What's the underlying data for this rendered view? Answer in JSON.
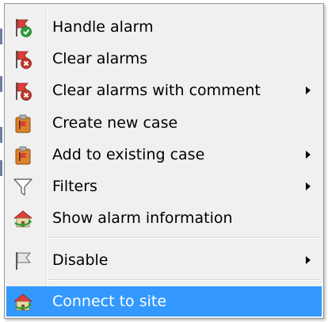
{
  "menu": {
    "items": [
      {
        "label": "Handle alarm",
        "icon": "handle-alarm-icon",
        "has_submenu": false
      },
      {
        "label": "Clear alarms",
        "icon": "clear-alarms-icon",
        "has_submenu": false
      },
      {
        "label": "Clear alarms with comment",
        "icon": "clear-alarms-comment-icon",
        "has_submenu": true
      },
      {
        "label": "Create new case",
        "icon": "create-case-icon",
        "has_submenu": false
      },
      {
        "label": "Add to existing case",
        "icon": "add-case-icon",
        "has_submenu": true
      },
      {
        "label": "Filters",
        "icon": "filter-icon",
        "has_submenu": true
      },
      {
        "label": "Show alarm information",
        "icon": "alarm-info-icon",
        "has_submenu": false
      },
      {
        "label": "Disable",
        "icon": "disable-flag-icon",
        "has_submenu": true
      },
      {
        "label": "Connect to site",
        "icon": "connect-site-icon",
        "has_submenu": false,
        "selected": true
      }
    ]
  },
  "colors": {
    "menu_bg": "#f0f0f0",
    "selection": "#3399ff",
    "flag_red": "#d9403a",
    "check_green": "#2f9e3a",
    "clear_red": "#c0392b",
    "case_orange": "#d9822b",
    "house_green": "#3a9a3a"
  }
}
